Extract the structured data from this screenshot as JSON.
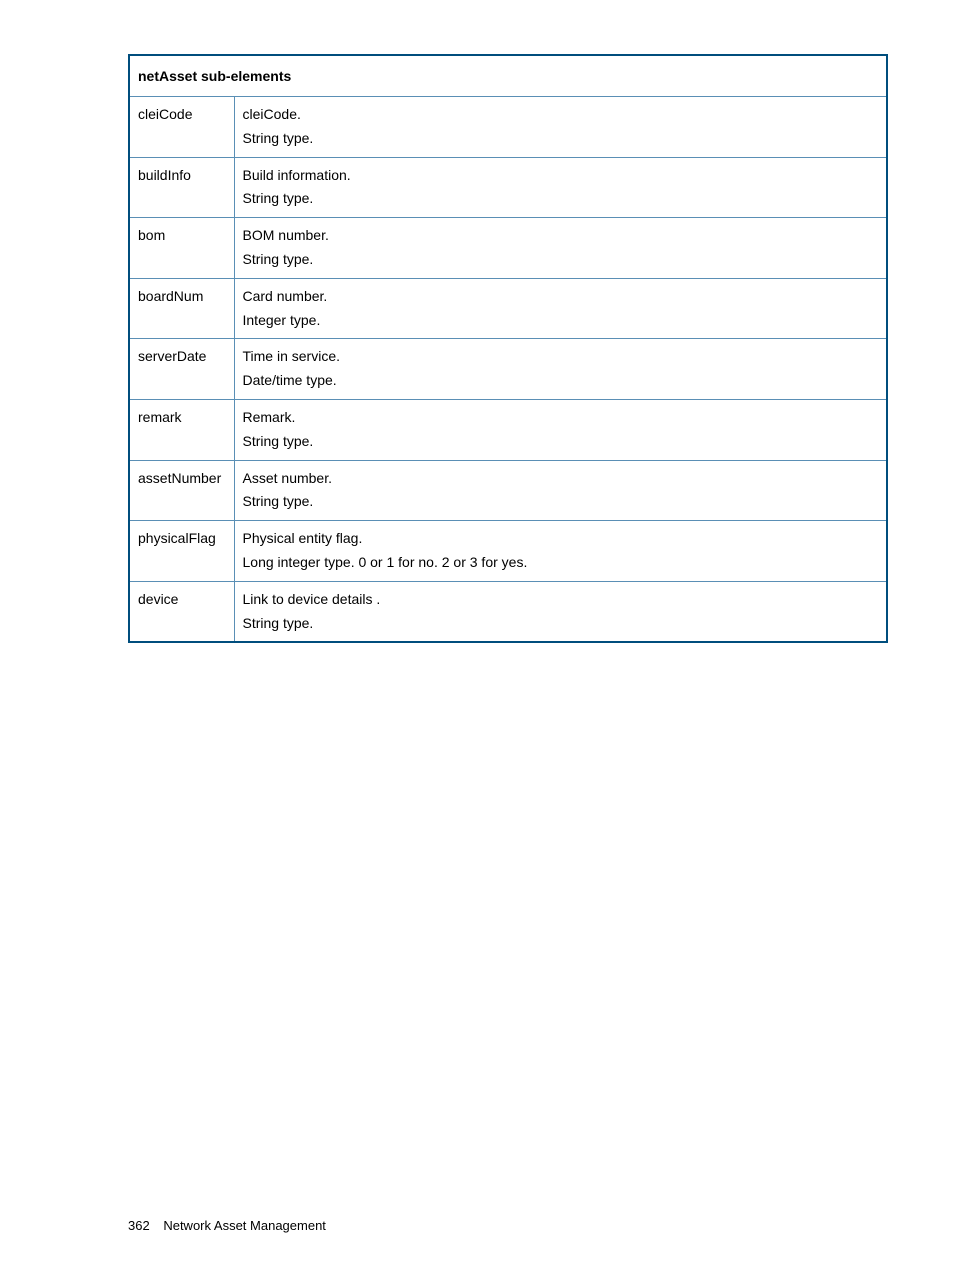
{
  "table": {
    "header": "netAsset sub-elements",
    "rows": [
      {
        "name": "cleiCode",
        "description": "cleiCode.",
        "type": "String type."
      },
      {
        "name": "buildInfo",
        "description": "Build information.",
        "type": "String type."
      },
      {
        "name": "bom",
        "description": "BOM number.",
        "type": "String type."
      },
      {
        "name": "boardNum",
        "description": "Card number.",
        "type": "Integer type."
      },
      {
        "name": "serverDate",
        "description": "Time in service.",
        "type": "Date/time type."
      },
      {
        "name": "remark",
        "description": "Remark.",
        "type": "String type."
      },
      {
        "name": "assetNumber",
        "description": "Asset number.",
        "type": "String type."
      },
      {
        "name": "physicalFlag",
        "description": "Physical entity flag.",
        "type": "Long integer type. 0 or 1 for no. 2 or 3 for yes."
      },
      {
        "name": "device",
        "description": "Link to device details .",
        "type": "String type."
      }
    ]
  },
  "footer": {
    "page_number": "362",
    "section_title": "Network Asset Management"
  }
}
